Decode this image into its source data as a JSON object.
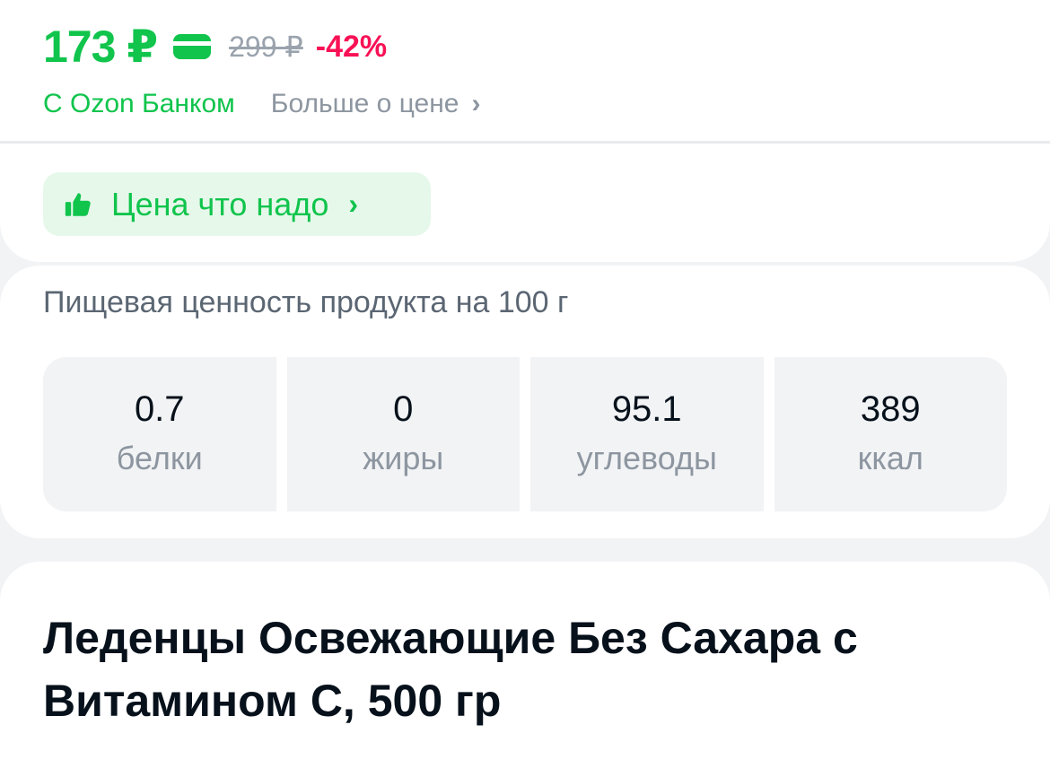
{
  "price": {
    "current": "173 ₽",
    "old": "299 ₽",
    "discount": "-42%",
    "bank_label": "С Ozon Банком",
    "more_link": "Больше о цене",
    "card_icon": "bank-card-icon"
  },
  "badge": {
    "label": "Цена что надо",
    "icon": "thumbs-up-icon"
  },
  "nutrition": {
    "title": "Пищевая ценность продукта на 100 г",
    "items": [
      {
        "value": "0.7",
        "label": "белки"
      },
      {
        "value": "0",
        "label": "жиры"
      },
      {
        "value": "95.1",
        "label": "углеводы"
      },
      {
        "value": "389",
        "label": "ккал"
      }
    ]
  },
  "product": {
    "title": "Леденцы Освежающие Без Сахара с Витамином С, 500 гр"
  },
  "colors": {
    "accent_green": "#10c44c",
    "discount_pink": "#f91155",
    "badge_bg": "#e6f8ea",
    "muted_text": "#8d96a0"
  }
}
